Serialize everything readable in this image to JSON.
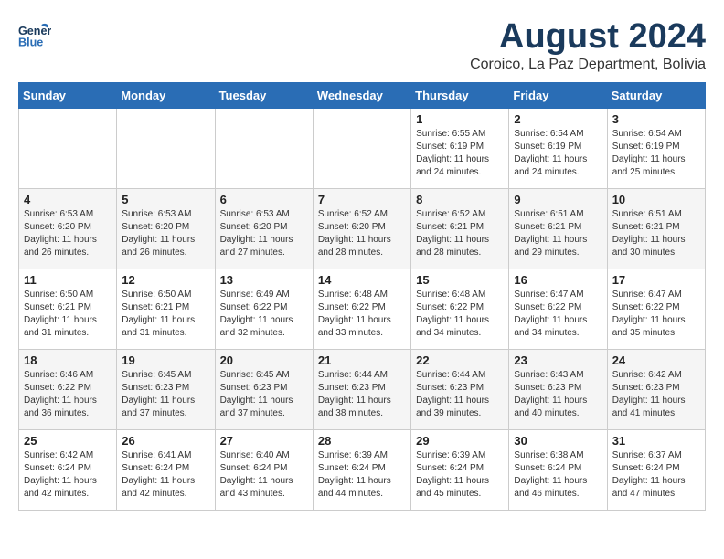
{
  "header": {
    "logo_line1": "General",
    "logo_line2": "Blue",
    "month": "August 2024",
    "location": "Coroico, La Paz Department, Bolivia"
  },
  "weekdays": [
    "Sunday",
    "Monday",
    "Tuesday",
    "Wednesday",
    "Thursday",
    "Friday",
    "Saturday"
  ],
  "weeks": [
    [
      {
        "day": "",
        "info": ""
      },
      {
        "day": "",
        "info": ""
      },
      {
        "day": "",
        "info": ""
      },
      {
        "day": "",
        "info": ""
      },
      {
        "day": "1",
        "info": "Sunrise: 6:55 AM\nSunset: 6:19 PM\nDaylight: 11 hours\nand 24 minutes."
      },
      {
        "day": "2",
        "info": "Sunrise: 6:54 AM\nSunset: 6:19 PM\nDaylight: 11 hours\nand 24 minutes."
      },
      {
        "day": "3",
        "info": "Sunrise: 6:54 AM\nSunset: 6:19 PM\nDaylight: 11 hours\nand 25 minutes."
      }
    ],
    [
      {
        "day": "4",
        "info": "Sunrise: 6:53 AM\nSunset: 6:20 PM\nDaylight: 11 hours\nand 26 minutes."
      },
      {
        "day": "5",
        "info": "Sunrise: 6:53 AM\nSunset: 6:20 PM\nDaylight: 11 hours\nand 26 minutes."
      },
      {
        "day": "6",
        "info": "Sunrise: 6:53 AM\nSunset: 6:20 PM\nDaylight: 11 hours\nand 27 minutes."
      },
      {
        "day": "7",
        "info": "Sunrise: 6:52 AM\nSunset: 6:20 PM\nDaylight: 11 hours\nand 28 minutes."
      },
      {
        "day": "8",
        "info": "Sunrise: 6:52 AM\nSunset: 6:21 PM\nDaylight: 11 hours\nand 28 minutes."
      },
      {
        "day": "9",
        "info": "Sunrise: 6:51 AM\nSunset: 6:21 PM\nDaylight: 11 hours\nand 29 minutes."
      },
      {
        "day": "10",
        "info": "Sunrise: 6:51 AM\nSunset: 6:21 PM\nDaylight: 11 hours\nand 30 minutes."
      }
    ],
    [
      {
        "day": "11",
        "info": "Sunrise: 6:50 AM\nSunset: 6:21 PM\nDaylight: 11 hours\nand 31 minutes."
      },
      {
        "day": "12",
        "info": "Sunrise: 6:50 AM\nSunset: 6:21 PM\nDaylight: 11 hours\nand 31 minutes."
      },
      {
        "day": "13",
        "info": "Sunrise: 6:49 AM\nSunset: 6:22 PM\nDaylight: 11 hours\nand 32 minutes."
      },
      {
        "day": "14",
        "info": "Sunrise: 6:48 AM\nSunset: 6:22 PM\nDaylight: 11 hours\nand 33 minutes."
      },
      {
        "day": "15",
        "info": "Sunrise: 6:48 AM\nSunset: 6:22 PM\nDaylight: 11 hours\nand 34 minutes."
      },
      {
        "day": "16",
        "info": "Sunrise: 6:47 AM\nSunset: 6:22 PM\nDaylight: 11 hours\nand 34 minutes."
      },
      {
        "day": "17",
        "info": "Sunrise: 6:47 AM\nSunset: 6:22 PM\nDaylight: 11 hours\nand 35 minutes."
      }
    ],
    [
      {
        "day": "18",
        "info": "Sunrise: 6:46 AM\nSunset: 6:22 PM\nDaylight: 11 hours\nand 36 minutes."
      },
      {
        "day": "19",
        "info": "Sunrise: 6:45 AM\nSunset: 6:23 PM\nDaylight: 11 hours\nand 37 minutes."
      },
      {
        "day": "20",
        "info": "Sunrise: 6:45 AM\nSunset: 6:23 PM\nDaylight: 11 hours\nand 37 minutes."
      },
      {
        "day": "21",
        "info": "Sunrise: 6:44 AM\nSunset: 6:23 PM\nDaylight: 11 hours\nand 38 minutes."
      },
      {
        "day": "22",
        "info": "Sunrise: 6:44 AM\nSunset: 6:23 PM\nDaylight: 11 hours\nand 39 minutes."
      },
      {
        "day": "23",
        "info": "Sunrise: 6:43 AM\nSunset: 6:23 PM\nDaylight: 11 hours\nand 40 minutes."
      },
      {
        "day": "24",
        "info": "Sunrise: 6:42 AM\nSunset: 6:23 PM\nDaylight: 11 hours\nand 41 minutes."
      }
    ],
    [
      {
        "day": "25",
        "info": "Sunrise: 6:42 AM\nSunset: 6:24 PM\nDaylight: 11 hours\nand 42 minutes."
      },
      {
        "day": "26",
        "info": "Sunrise: 6:41 AM\nSunset: 6:24 PM\nDaylight: 11 hours\nand 42 minutes."
      },
      {
        "day": "27",
        "info": "Sunrise: 6:40 AM\nSunset: 6:24 PM\nDaylight: 11 hours\nand 43 minutes."
      },
      {
        "day": "28",
        "info": "Sunrise: 6:39 AM\nSunset: 6:24 PM\nDaylight: 11 hours\nand 44 minutes."
      },
      {
        "day": "29",
        "info": "Sunrise: 6:39 AM\nSunset: 6:24 PM\nDaylight: 11 hours\nand 45 minutes."
      },
      {
        "day": "30",
        "info": "Sunrise: 6:38 AM\nSunset: 6:24 PM\nDaylight: 11 hours\nand 46 minutes."
      },
      {
        "day": "31",
        "info": "Sunrise: 6:37 AM\nSunset: 6:24 PM\nDaylight: 11 hours\nand 47 minutes."
      }
    ]
  ]
}
